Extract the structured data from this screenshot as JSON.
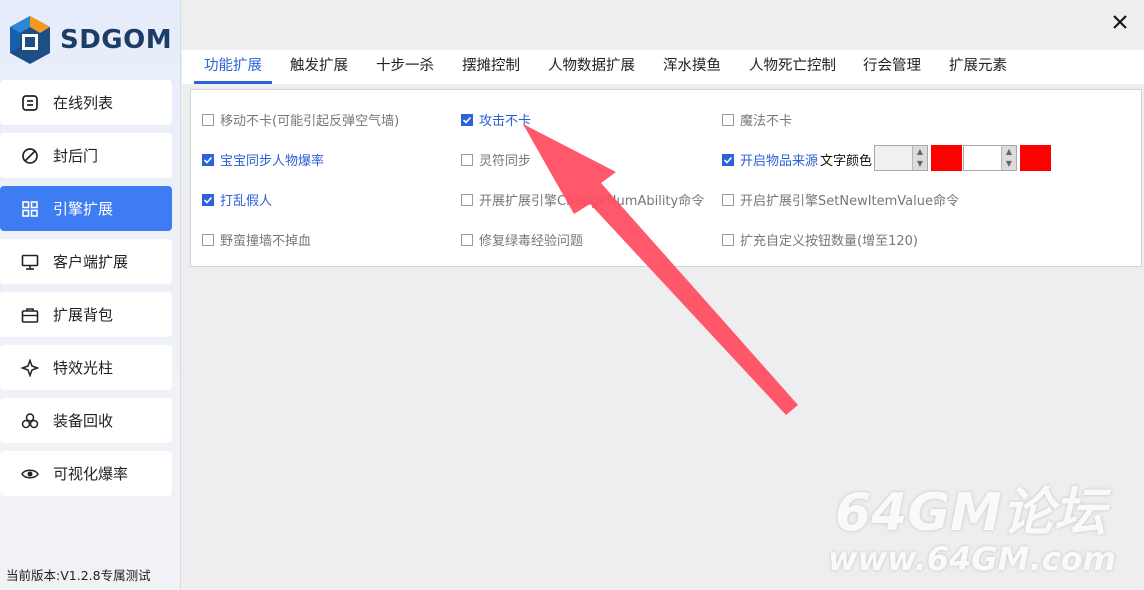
{
  "brand": {
    "name": "SDGOM"
  },
  "sidebar": {
    "items": [
      {
        "label": "在线列表",
        "icon": "list-icon"
      },
      {
        "label": "封后门",
        "icon": "block-icon"
      },
      {
        "label": "引擎扩展",
        "icon": "grid-icon",
        "active": true
      },
      {
        "label": "客户端扩展",
        "icon": "monitor-icon"
      },
      {
        "label": "扩展背包",
        "icon": "briefcase-icon"
      },
      {
        "label": "特效光柱",
        "icon": "sparkle-icon"
      },
      {
        "label": "装备回收",
        "icon": "recycle-icon"
      },
      {
        "label": "可视化爆率",
        "icon": "eye-icon"
      }
    ]
  },
  "footer": {
    "version": "当前版本:V1.2.8专属测试"
  },
  "tabs": [
    {
      "label": "功能扩展",
      "active": true
    },
    {
      "label": "触发扩展"
    },
    {
      "label": "十步一杀"
    },
    {
      "label": "摆摊控制"
    },
    {
      "label": "人物数据扩展"
    },
    {
      "label": "浑水摸鱼"
    },
    {
      "label": "人物死亡控制"
    },
    {
      "label": "行会管理"
    },
    {
      "label": "扩展元素"
    }
  ],
  "options": [
    {
      "label": "移动不卡(可能引起反弹空气墙)",
      "checked": false
    },
    {
      "label": "攻击不卡",
      "checked": true
    },
    {
      "label": "魔法不卡",
      "checked": false
    },
    {
      "label": "宝宝同步人物爆率",
      "checked": true
    },
    {
      "label": "灵符同步",
      "checked": false
    },
    {
      "label": "开启物品来源",
      "checked": true
    },
    {
      "label": "打乱假人",
      "checked": true
    },
    {
      "label": "开展扩展引擎ChangeHumAbility命令",
      "checked": false
    },
    {
      "label": "开启扩展引擎SetNewItemValue命令",
      "checked": false
    },
    {
      "label": "野蛮撞墙不掉血",
      "checked": false
    },
    {
      "label": "修复绿毒经验问题",
      "checked": false
    },
    {
      "label": "扩充自定义按钮数量(增至120)",
      "checked": false
    }
  ],
  "color_setting": {
    "label": "文字颜色",
    "swatch_color": "#ff0000"
  },
  "annotation": {
    "arrow_color": "#ff4a5e"
  },
  "watermark": {
    "line1": "64GM论坛",
    "line2": "www.64GM.com"
  },
  "colors": {
    "accent": "#3d7cf2",
    "checked_text": "#2a5fd6"
  }
}
